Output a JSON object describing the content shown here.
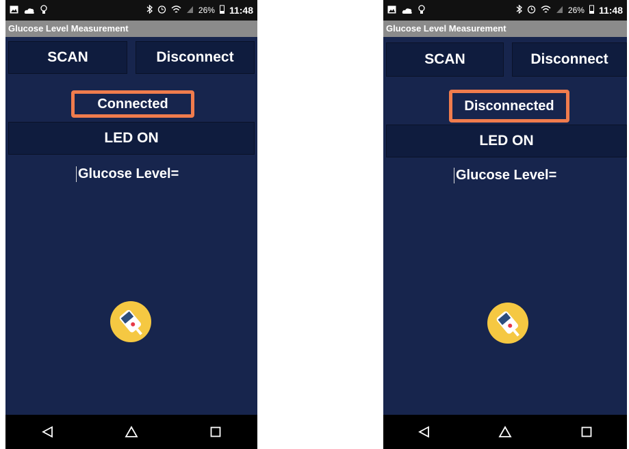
{
  "screens": [
    {
      "status_bar": {
        "battery": "26%",
        "time": "11:48"
      },
      "app_title": "Glucose Level Measurement",
      "scan_label": "SCAN",
      "disconnect_label": "Disconnect",
      "connection_status": "Connected",
      "led_label": "LED ON",
      "glucose_label": "Glucose Level="
    },
    {
      "status_bar": {
        "battery": "26%",
        "time": "11:48"
      },
      "app_title": "Glucose Level Measurement",
      "scan_label": "SCAN",
      "disconnect_label": "Disconnect",
      "connection_status": "Disconnected",
      "led_label": "LED ON",
      "glucose_label": "Glucose Level="
    }
  ],
  "colors": {
    "background": "#17254d",
    "button": "#0f1c3e",
    "highlight": "#f07c4d",
    "icon_bg": "#f5c842"
  },
  "icons": [
    "image-icon",
    "cloud-icon",
    "bulb-icon",
    "bluetooth-icon",
    "alarm-icon",
    "wifi-icon",
    "signal-icon",
    "battery-icon",
    "glucose-meter-icon",
    "back-icon",
    "home-icon",
    "recents-icon"
  ]
}
